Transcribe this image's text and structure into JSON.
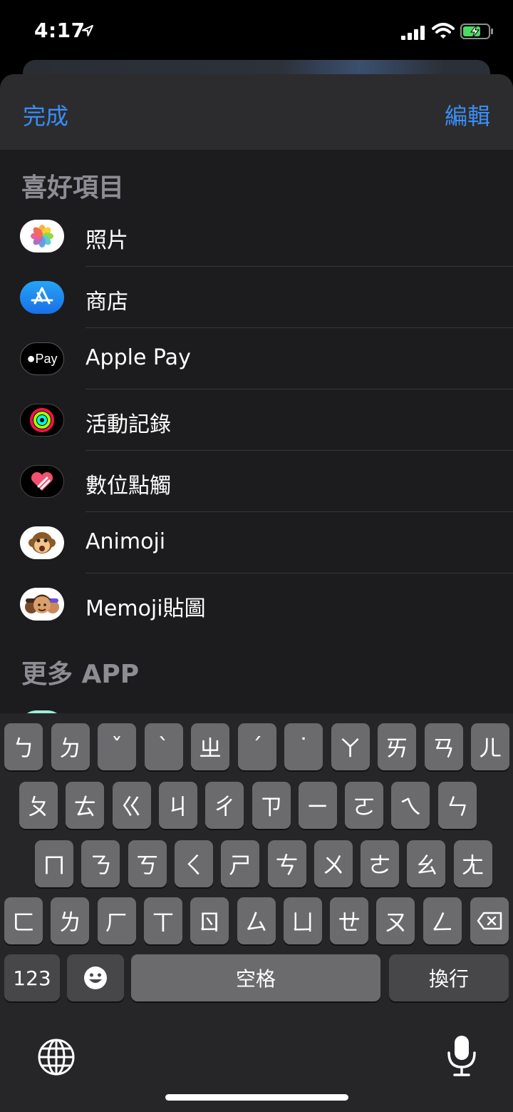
{
  "status_bar": {
    "time": "4:17"
  },
  "sheet": {
    "done_label": "完成",
    "edit_label": "編輯",
    "favorites_title": "喜好項目",
    "more_apps_title": "更多 APP",
    "favorites": [
      {
        "label": "照片",
        "icon": "photos-icon"
      },
      {
        "label": "商店",
        "icon": "app-store-icon"
      },
      {
        "label": "Apple Pay",
        "icon": "apple-pay-icon",
        "icon_text": "Pay"
      },
      {
        "label": "活動記錄",
        "icon": "activity-icon"
      },
      {
        "label": "數位點觸",
        "icon": "digital-touch-icon"
      },
      {
        "label": "Animoji",
        "icon": "animoji-icon"
      },
      {
        "label": "Memoji貼圖",
        "icon": "memoji-stickers-icon"
      }
    ]
  },
  "keyboard": {
    "row1": [
      "ㄅ",
      "ㄉ",
      "ˇ",
      "ˋ",
      "ㄓ",
      "ˊ",
      "˙",
      "ㄚ",
      "ㄞ",
      "ㄢ",
      "ㄦ"
    ],
    "row2": [
      "ㄆ",
      "ㄊ",
      "ㄍ",
      "ㄐ",
      "ㄔ",
      "ㄗ",
      "ㄧ",
      "ㄛ",
      "ㄟ",
      "ㄣ"
    ],
    "row3": [
      "ㄇ",
      "ㄋ",
      "ㄎ",
      "ㄑ",
      "ㄕ",
      "ㄘ",
      "ㄨ",
      "ㄜ",
      "ㄠ",
      "ㄤ"
    ],
    "row4": [
      "ㄈ",
      "ㄌ",
      "ㄏ",
      "ㄒ",
      "ㄖ",
      "ㄙ",
      "ㄩ",
      "ㄝ",
      "ㄡ",
      "ㄥ"
    ],
    "numbers_label": "123",
    "space_label": "空格",
    "return_label": "換行"
  },
  "colors": {
    "accent": "#3a8ef6",
    "sheet_bg": "#1c1c1e",
    "key_bg": "#6b6b6e"
  }
}
